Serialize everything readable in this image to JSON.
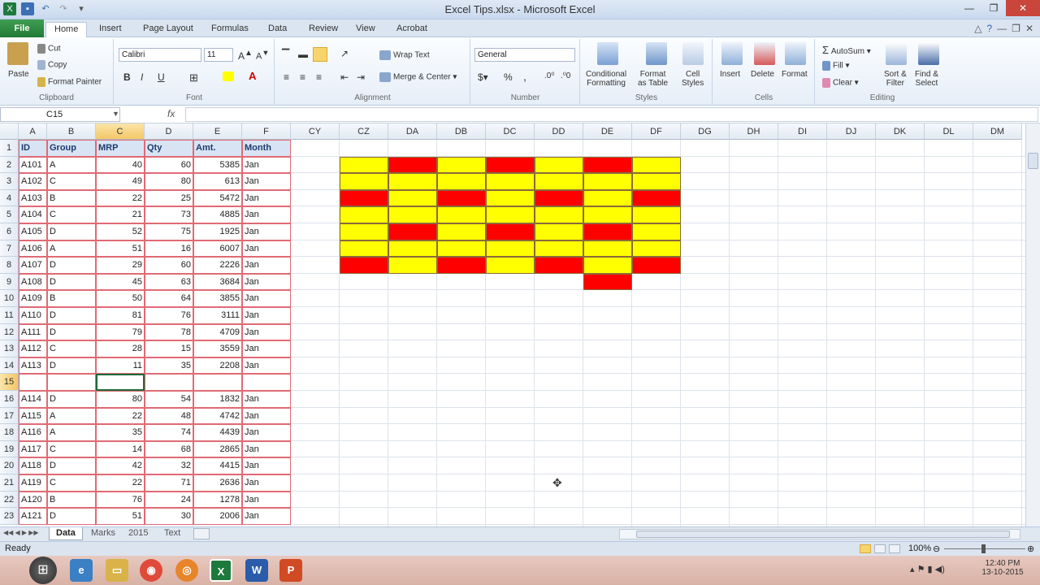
{
  "window": {
    "title": "Excel Tips.xlsx - Microsoft Excel"
  },
  "tabs": [
    "File",
    "Home",
    "Insert",
    "Page Layout",
    "Formulas",
    "Data",
    "Review",
    "View",
    "Acrobat"
  ],
  "ribbon": {
    "clipboard": {
      "paste": "Paste",
      "cut": "Cut",
      "copy": "Copy",
      "format_painter": "Format Painter",
      "label": "Clipboard"
    },
    "font": {
      "name": "Calibri",
      "size": "11",
      "bold": "B",
      "italic": "I",
      "underline": "U",
      "label": "Font"
    },
    "alignment": {
      "wrap": "Wrap Text",
      "merge": "Merge & Center",
      "label": "Alignment"
    },
    "number": {
      "format": "General",
      "percent": "%",
      "comma": ",",
      "label": "Number"
    },
    "styles": {
      "conditional": "Conditional",
      "conditional2": "Formatting",
      "format_table": "Format",
      "format_table2": "as Table",
      "cell_styles": "Cell",
      "cell_styles2": "Styles",
      "label": "Styles"
    },
    "cells": {
      "insert": "Insert",
      "delete": "Delete",
      "format": "Format",
      "label": "Cells"
    },
    "editing": {
      "autosum": "AutoSum",
      "fill": "Fill",
      "clear": "Clear",
      "sort": "Sort &",
      "sort2": "Filter",
      "find": "Find &",
      "find2": "Select",
      "label": "Editing"
    }
  },
  "formula_bar": {
    "name_box": "C15",
    "fx": "fx",
    "value": ""
  },
  "columns_left": [
    "A",
    "B",
    "C",
    "D",
    "E",
    "F"
  ],
  "columns_right": [
    "CY",
    "CZ",
    "DA",
    "DB",
    "DC",
    "DD",
    "DE",
    "DF",
    "DG",
    "DH",
    "DI",
    "DJ",
    "DK",
    "DL",
    "DM"
  ],
  "table": {
    "headers": [
      "ID",
      "Group",
      "MRP",
      "Qty",
      "Amt.",
      "Month"
    ],
    "rows": [
      [
        "1",
        [
          "ID",
          "Group",
          "MRP",
          "Qty",
          "Amt.",
          "Month"
        ]
      ],
      [
        "2",
        [
          "A101",
          "A",
          "40",
          "60",
          "5385",
          "Jan"
        ]
      ],
      [
        "3",
        [
          "A102",
          "C",
          "49",
          "80",
          "613",
          "Jan"
        ]
      ],
      [
        "4",
        [
          "A103",
          "B",
          "22",
          "25",
          "5472",
          "Jan"
        ]
      ],
      [
        "5",
        [
          "A104",
          "C",
          "21",
          "73",
          "4885",
          "Jan"
        ]
      ],
      [
        "6",
        [
          "A105",
          "D",
          "52",
          "75",
          "1925",
          "Jan"
        ]
      ],
      [
        "7",
        [
          "A106",
          "A",
          "51",
          "16",
          "6007",
          "Jan"
        ]
      ],
      [
        "8",
        [
          "A107",
          "D",
          "29",
          "60",
          "2226",
          "Jan"
        ]
      ],
      [
        "9",
        [
          "A108",
          "D",
          "45",
          "63",
          "3684",
          "Jan"
        ]
      ],
      [
        "10",
        [
          "A109",
          "B",
          "50",
          "64",
          "3855",
          "Jan"
        ]
      ],
      [
        "11",
        [
          "A110",
          "D",
          "81",
          "76",
          "3111",
          "Jan"
        ]
      ],
      [
        "12",
        [
          "A111",
          "D",
          "79",
          "78",
          "4709",
          "Jan"
        ]
      ],
      [
        "13",
        [
          "A112",
          "C",
          "28",
          "15",
          "3559",
          "Jan"
        ]
      ],
      [
        "14",
        [
          "A113",
          "D",
          "11",
          "35",
          "2208",
          "Jan"
        ]
      ],
      [
        "15",
        [
          "",
          "",
          "",
          "",
          "",
          ""
        ]
      ],
      [
        "16",
        [
          "A114",
          "D",
          "80",
          "54",
          "1832",
          "Jan"
        ]
      ],
      [
        "17",
        [
          "A115",
          "A",
          "22",
          "48",
          "4742",
          "Jan"
        ]
      ],
      [
        "18",
        [
          "A116",
          "A",
          "35",
          "74",
          "4439",
          "Jan"
        ]
      ],
      [
        "19",
        [
          "A117",
          "C",
          "14",
          "68",
          "2865",
          "Jan"
        ]
      ],
      [
        "20",
        [
          "A118",
          "D",
          "42",
          "32",
          "4415",
          "Jan"
        ]
      ],
      [
        "21",
        [
          "A119",
          "C",
          "22",
          "71",
          "2636",
          "Jan"
        ]
      ],
      [
        "22",
        [
          "A120",
          "B",
          "76",
          "24",
          "1278",
          "Jan"
        ]
      ],
      [
        "23",
        [
          "A121",
          "D",
          "51",
          "30",
          "2006",
          "Jan"
        ]
      ]
    ]
  },
  "colored_block": {
    "colors": {
      "Y": "#ffff00",
      "R": "#ff0000"
    },
    "grid": [
      "YRYRYRY",
      "YYYYYYY",
      "RYRYRYR",
      "YYYYYYY",
      "YRYRYRY",
      "YYYYYYY",
      "RYRYRYR",
      "-----R-"
    ]
  },
  "sheets": [
    "Data",
    "Marks",
    "2015",
    "Text"
  ],
  "status": {
    "ready": "Ready",
    "zoom": "100%"
  },
  "taskbar": {
    "time": "12:40 PM",
    "date": "13-10-2015"
  }
}
